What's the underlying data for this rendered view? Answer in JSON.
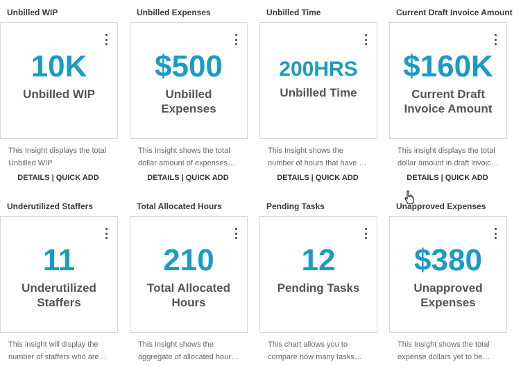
{
  "row1": [
    {
      "title": "Unbilled WIP",
      "value": "10K",
      "label": "Unbilled WIP",
      "desc1": "This Insight displays the total",
      "desc2": "Unbilled WIP",
      "details": "DETAILS",
      "sep": "|",
      "quick_add": "QUICK ADD"
    },
    {
      "title": "Unbilled Expenses",
      "value": "$500",
      "label": "Unbilled Expenses",
      "desc1": "This Insight shows the total",
      "desc2": "dollar amount of expenses…",
      "details": "DETAILS",
      "sep": "|",
      "quick_add": "QUICK ADD"
    },
    {
      "title": "Unbilled Time",
      "value": "200HRS",
      "label": "Unbilled Time",
      "desc1": "This Insight shows the",
      "desc2": "number of hours that have …",
      "details": "DETAILS",
      "sep": "|",
      "quick_add": "QUICK ADD"
    },
    {
      "title": "Current Draft Invoice Amount",
      "value": "$160K",
      "label": "Current Draft Invoice Amount",
      "desc1": "This insight displays the total",
      "desc2": "dollar amount in draft invoic…",
      "details": "DETAILS",
      "sep": "|",
      "quick_add": "QUICK ADD"
    }
  ],
  "row2": [
    {
      "title": "Underutilized Staffers",
      "value": "11",
      "label": "Underutilized Staffers",
      "desc1": "This insight will display the",
      "desc2": "number of staffers who are…"
    },
    {
      "title": "Total Allocated Hours",
      "value": "210",
      "label": "Total Allocated Hours",
      "desc1": "This Insight shows the",
      "desc2": "aggregate of allocated hour…"
    },
    {
      "title": "Pending Tasks",
      "value": "12",
      "label": "Pending Tasks",
      "desc1": "This chart allows you to",
      "desc2": "compare how many tasks…"
    },
    {
      "title": "Unapproved Expenses",
      "value": "$380",
      "label": "Unapproved Expenses",
      "desc1": "This Insight shows the total",
      "desc2": "expense dollars yet to be…"
    }
  ],
  "icons": {
    "menu": "kebab-menu-icon",
    "cursor": "hand-pointer-cursor-icon"
  },
  "colors": {
    "value": "#1a9bc6",
    "label": "#555555",
    "border": "#d8d8d8"
  }
}
